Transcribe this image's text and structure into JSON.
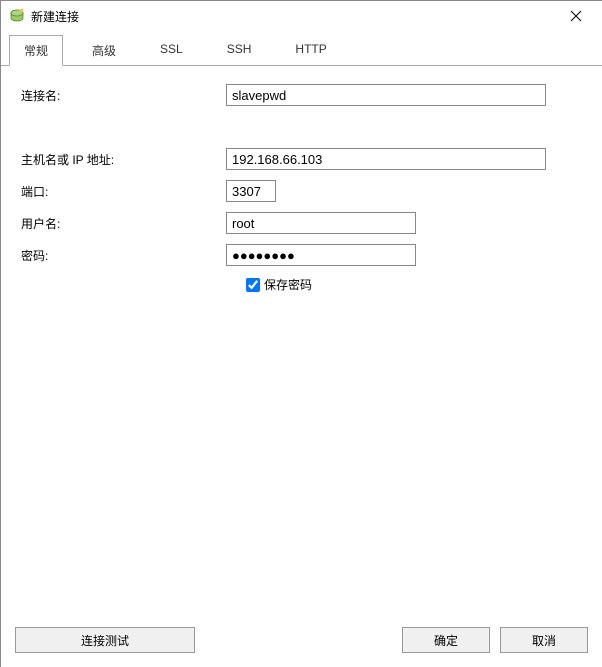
{
  "window": {
    "title": "新建连接"
  },
  "tabs": {
    "items": [
      {
        "label": "常规"
      },
      {
        "label": "高级"
      },
      {
        "label": "SSL"
      },
      {
        "label": "SSH"
      },
      {
        "label": "HTTP"
      }
    ]
  },
  "form": {
    "connection_name_label": "连接名:",
    "connection_name_value": "slavepwd",
    "host_label": "主机名或 IP 地址:",
    "host_value": "192.168.66.103",
    "port_label": "端口:",
    "port_value": "3307",
    "user_label": "用户名:",
    "user_value": "root",
    "password_label": "密码:",
    "password_value": "●●●●●●●●",
    "save_password_label": "保存密码",
    "save_password_checked": true
  },
  "footer": {
    "test_label": "连接测试",
    "ok_label": "确定",
    "cancel_label": "取消"
  }
}
